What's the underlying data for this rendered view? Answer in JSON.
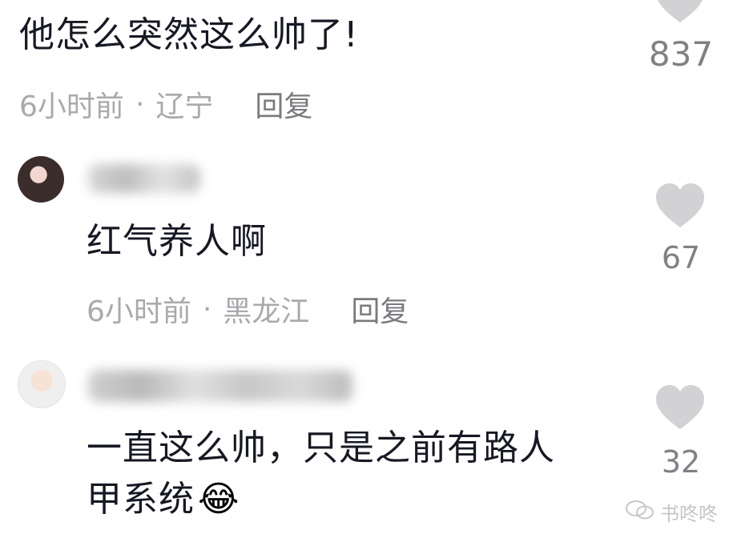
{
  "comments": [
    {
      "text": "他怎么突然这么帅了!",
      "time": "6小时前",
      "separator": "·",
      "location": "辽宁",
      "reply_label": "回复",
      "likes": "837"
    },
    {
      "text": "红气养人啊",
      "time": "6小时前",
      "separator": "·",
      "location": "黑龙江",
      "reply_label": "回复",
      "likes": "67"
    },
    {
      "text_line1": "一直这么帅，只是之前有路人",
      "text_line2": "甲系统",
      "emoji": "😂",
      "likes": "32"
    }
  ],
  "watermark": {
    "text": "书咚咚"
  },
  "icons": {
    "like": "heart-icon",
    "watermark_logo": "wechat-icon"
  },
  "colors": {
    "text": "#161823",
    "meta": "#a9a9ae",
    "like_heart": "#d2d2d4"
  }
}
